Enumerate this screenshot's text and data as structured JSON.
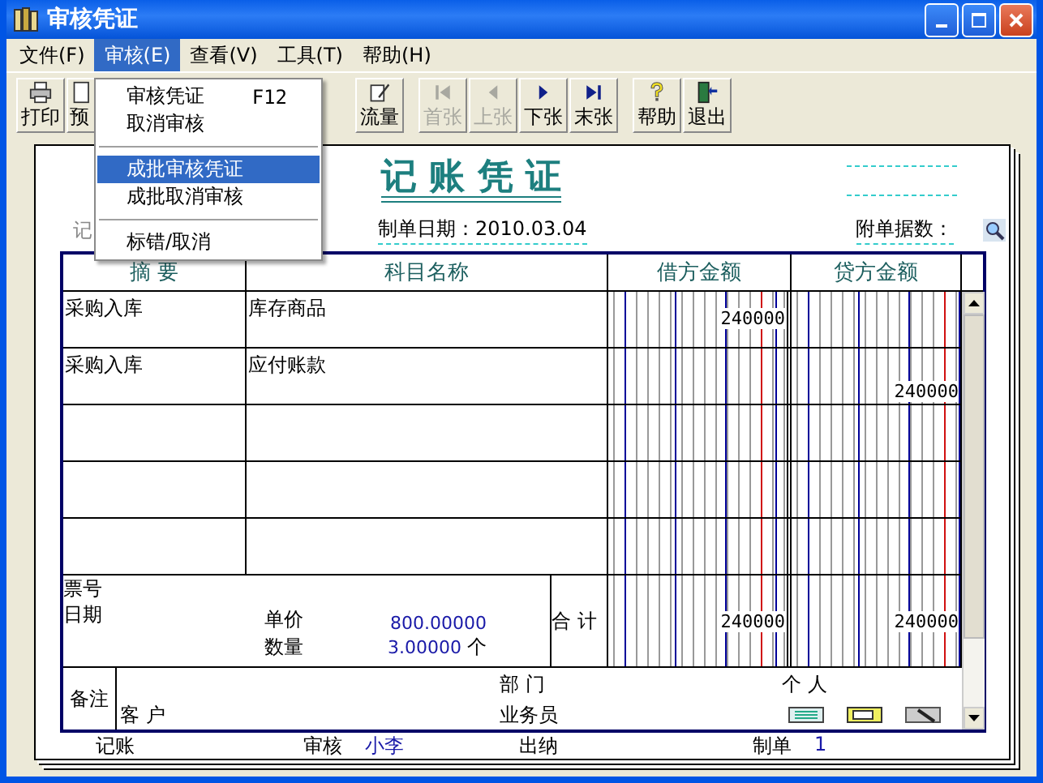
{
  "window": {
    "title": "审核凭证"
  },
  "menu_bar": [
    {
      "label": "文件(F)",
      "selected": false
    },
    {
      "label": "审核(E)",
      "selected": true
    },
    {
      "label": "查看(V)",
      "selected": false
    },
    {
      "label": "工具(T)",
      "selected": false
    },
    {
      "label": "帮助(H)",
      "selected": false
    }
  ],
  "open_menu": [
    {
      "kind": "item",
      "label": "审核凭证",
      "shortcut": "F12",
      "selected": false
    },
    {
      "kind": "item",
      "label": "取消审核",
      "selected": false
    },
    {
      "kind": "separator"
    },
    {
      "kind": "item",
      "label": "成批审核凭证",
      "selected": true
    },
    {
      "kind": "item",
      "label": "成批取消审核",
      "selected": false
    },
    {
      "kind": "separator"
    },
    {
      "kind": "item",
      "label": "标错/取消",
      "selected": false
    }
  ],
  "toolbar": [
    {
      "kind": "print",
      "label": "打印",
      "disabled": false
    },
    {
      "kind": "preview",
      "label": "预",
      "disabled": false
    },
    {
      "kind": "gap"
    },
    {
      "kind": "flow",
      "label": "流量",
      "disabled": false
    },
    {
      "kind": "first",
      "label": "首张",
      "disabled": true
    },
    {
      "kind": "prev",
      "label": "上张",
      "disabled": true
    },
    {
      "kind": "next",
      "label": "下张",
      "disabled": false
    },
    {
      "kind": "last",
      "label": "末张",
      "disabled": false
    },
    {
      "kind": "help",
      "label": "帮助",
      "disabled": false
    },
    {
      "kind": "exit",
      "label": "退出",
      "disabled": false
    }
  ],
  "voucher": {
    "title": "记 账 凭 证",
    "word_label": "记",
    "date": "制单日期：2010.03.04",
    "attachments_label": "附单据数：",
    "columns": [
      "摘 要",
      "科目名称",
      "借方金额",
      "贷方金额"
    ],
    "entries": [
      {
        "kind": "entry",
        "summary": "采购入库",
        "account": "库存商品",
        "debit": "240000"
      },
      {
        "kind": "entry",
        "summary": "采购入库",
        "account": "应付账款",
        "credit": "240000"
      },
      {
        "kind": "blank"
      },
      {
        "kind": "blank"
      },
      {
        "kind": "blank"
      }
    ],
    "bill_no_label": "票号",
    "date_label": "日期",
    "unit_price_label": "单价",
    "unit_price": "800.00000",
    "quantity_label": "数量",
    "quantity": "3.00000",
    "unit": "个",
    "total_label": "合 计",
    "total_debit": "240000",
    "total_credit": "240000",
    "remark_label": "备注",
    "customer_label": "客 户",
    "department_label": "部 门",
    "salesperson_label": "业务员",
    "person_label": "个 人",
    "signatures": [
      {
        "label": "记账"
      },
      {
        "label": "审核",
        "value": "小李"
      },
      {
        "label": "出纳"
      },
      {
        "label": "制单",
        "value": "1"
      }
    ]
  }
}
